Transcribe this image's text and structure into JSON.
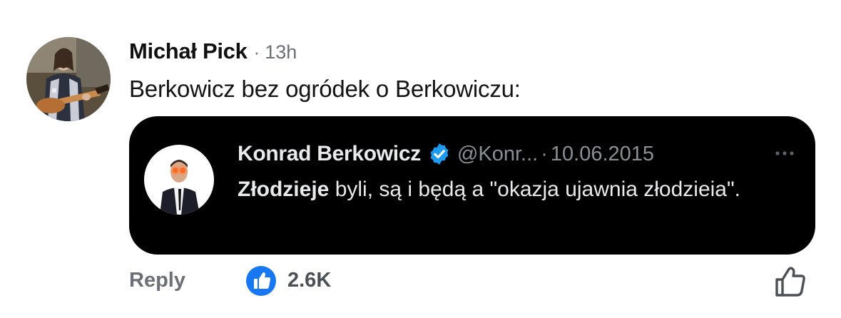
{
  "comment": {
    "author": "Michał Pick",
    "separator": "·",
    "time": "13h",
    "text": "Berkowicz bez ogródek o Berkowiczu:"
  },
  "quote": {
    "name": "Konrad Berkowicz",
    "handle": "@Konr...",
    "separator": "·",
    "date": "10.06.2015",
    "text_bold": "Złodzieje",
    "text_rest": " byli, są i będą a \"okazja ujawnia złodzieia\".",
    "more_icon": "more-dots-icon",
    "verified_icon": "verified-badge-icon",
    "verified_color": "#1d9bf0"
  },
  "actions": {
    "reply_label": "Reply",
    "like_count": "2.6K",
    "like_color": "#1877f2",
    "like_icon": "like-reaction-icon",
    "thumb_icon": "thumbs-up-outline-icon"
  }
}
